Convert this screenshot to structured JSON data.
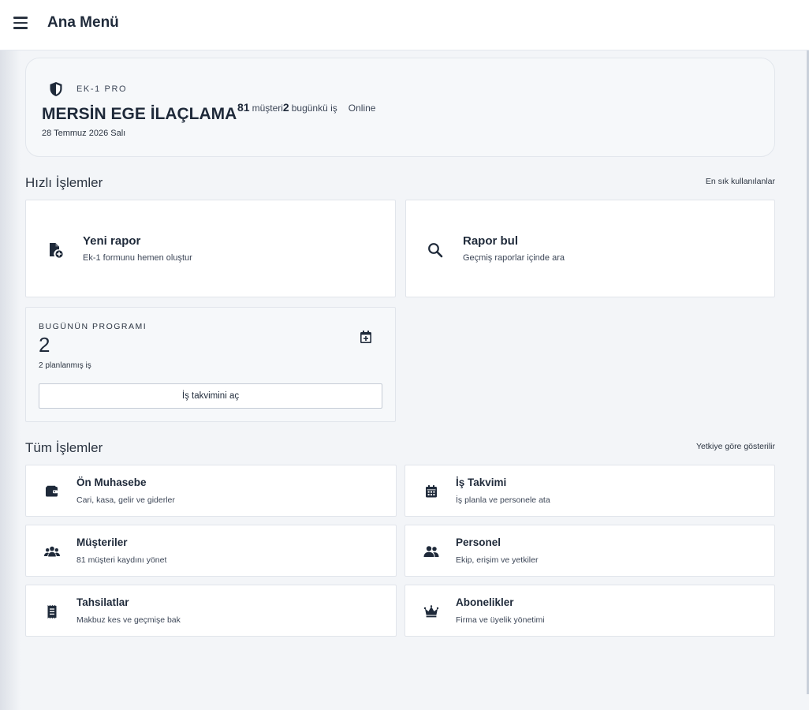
{
  "header": {
    "title": "Ana Menü",
    "menu_icon": "hamburger-menu-icon"
  },
  "hero": {
    "brand": "EK-1 PRO",
    "brand_icon": "shield-icon",
    "company": "MERSİN EGE İLAÇLAMA",
    "date": "28 Temmuz 2026 Salı",
    "customers_count": "81",
    "customers_label": "müşteri",
    "jobs_count": "2",
    "jobs_label": "bugünkü iş",
    "status": "Online"
  },
  "quick": {
    "title": "Hızlı İşlemler",
    "note": "En sık kullanılanlar",
    "cards": [
      {
        "title": "Yeni rapor",
        "sub": "Ek-1 formunu hemen oluştur",
        "icon": "new-report-file-icon"
      },
      {
        "title": "Rapor bul",
        "sub": "Geçmiş raporlar içinde ara",
        "icon": "search-icon"
      }
    ]
  },
  "program": {
    "label": "BUGÜNÜN PROGRAMI",
    "count": "2",
    "sub": "2 planlanmış iş",
    "button": "İş takvimini aç",
    "icon": "calendar-add-icon"
  },
  "all": {
    "title": "Tüm İşlemler",
    "note": "Yetkiye göre gösterilir",
    "items": [
      {
        "title": "Ön Muhasebe",
        "sub": "Cari, kasa, gelir ve giderler",
        "icon": "wallet-icon"
      },
      {
        "title": "İş Takvimi",
        "sub": "İş planla ve personele ata",
        "icon": "calendar-icon"
      },
      {
        "title": "Müşteriler",
        "sub": "81 müşteri kaydını yönet",
        "icon": "group-icon"
      },
      {
        "title": "Personel",
        "sub": "Ekip, erişim ve yetkiler",
        "icon": "people-icon"
      },
      {
        "title": "Tahsilatlar",
        "sub": "Makbuz kes ve geçmişe bak",
        "icon": "receipt-icon"
      },
      {
        "title": "Abonelikler",
        "sub": "Firma ve üyelik yönetimi",
        "icon": "crown-icon"
      }
    ]
  },
  "colors": {
    "text": "#1f2a3a",
    "background": "#f3f5f8",
    "card": "#ffffff",
    "accent": "#3b6fd8"
  }
}
